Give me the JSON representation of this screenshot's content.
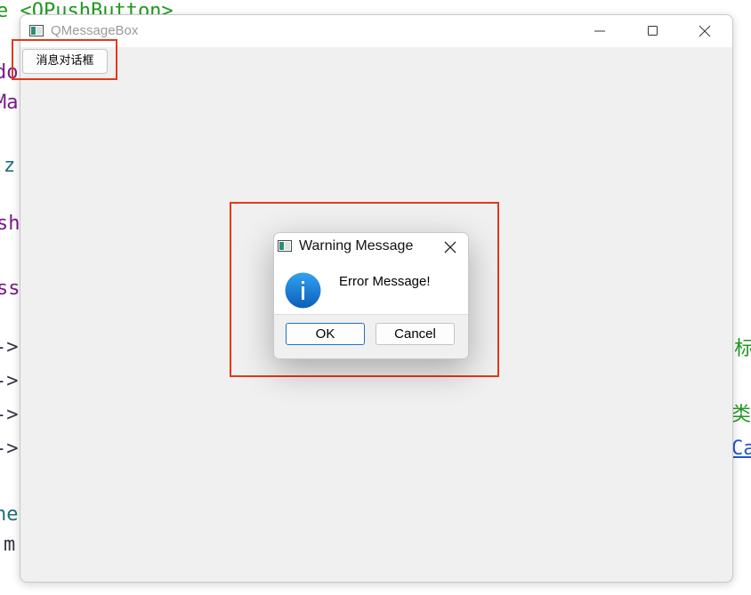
{
  "background_code": [
    {
      "text": "e <QPushButton>",
      "color": "#1f9a1f"
    },
    {
      "text": "do",
      "color": "#7a1a8a"
    },
    {
      "text": "Ma",
      "color": "#7a1a8a"
    },
    {
      "text": "z",
      "color": "#1f6f7a"
    },
    {
      "text": "sh",
      "color": "#7a1a8a"
    },
    {
      "text": "ss",
      "color": "#7a1a8a"
    },
    {
      "text": "->",
      "color": "#333344"
    },
    {
      "text": "->",
      "color": "#333344"
    },
    {
      "text": "->",
      "color": "#333344"
    },
    {
      "text": "->",
      "color": "#333344"
    },
    {
      "text": "he",
      "color": "#1f6f7a"
    },
    {
      "text": "m",
      "color": "#333344"
    },
    {
      "text": "j标",
      "color": "#1f9a1f"
    },
    {
      "text": "类",
      "color": "#1f9a1f"
    },
    {
      "text": "Ca",
      "color": "#2255cc"
    }
  ],
  "window": {
    "title": "QMessageBox",
    "button_label": "消息对话框"
  },
  "dialog": {
    "title": "Warning Message",
    "message": "Error Message!",
    "icon": "information-icon",
    "ok_label": "OK",
    "cancel_label": "Cancel"
  },
  "colors": {
    "annotation": "#e03a1a",
    "accent": "#1a73c6",
    "window_bg": "#f0f0f0"
  }
}
